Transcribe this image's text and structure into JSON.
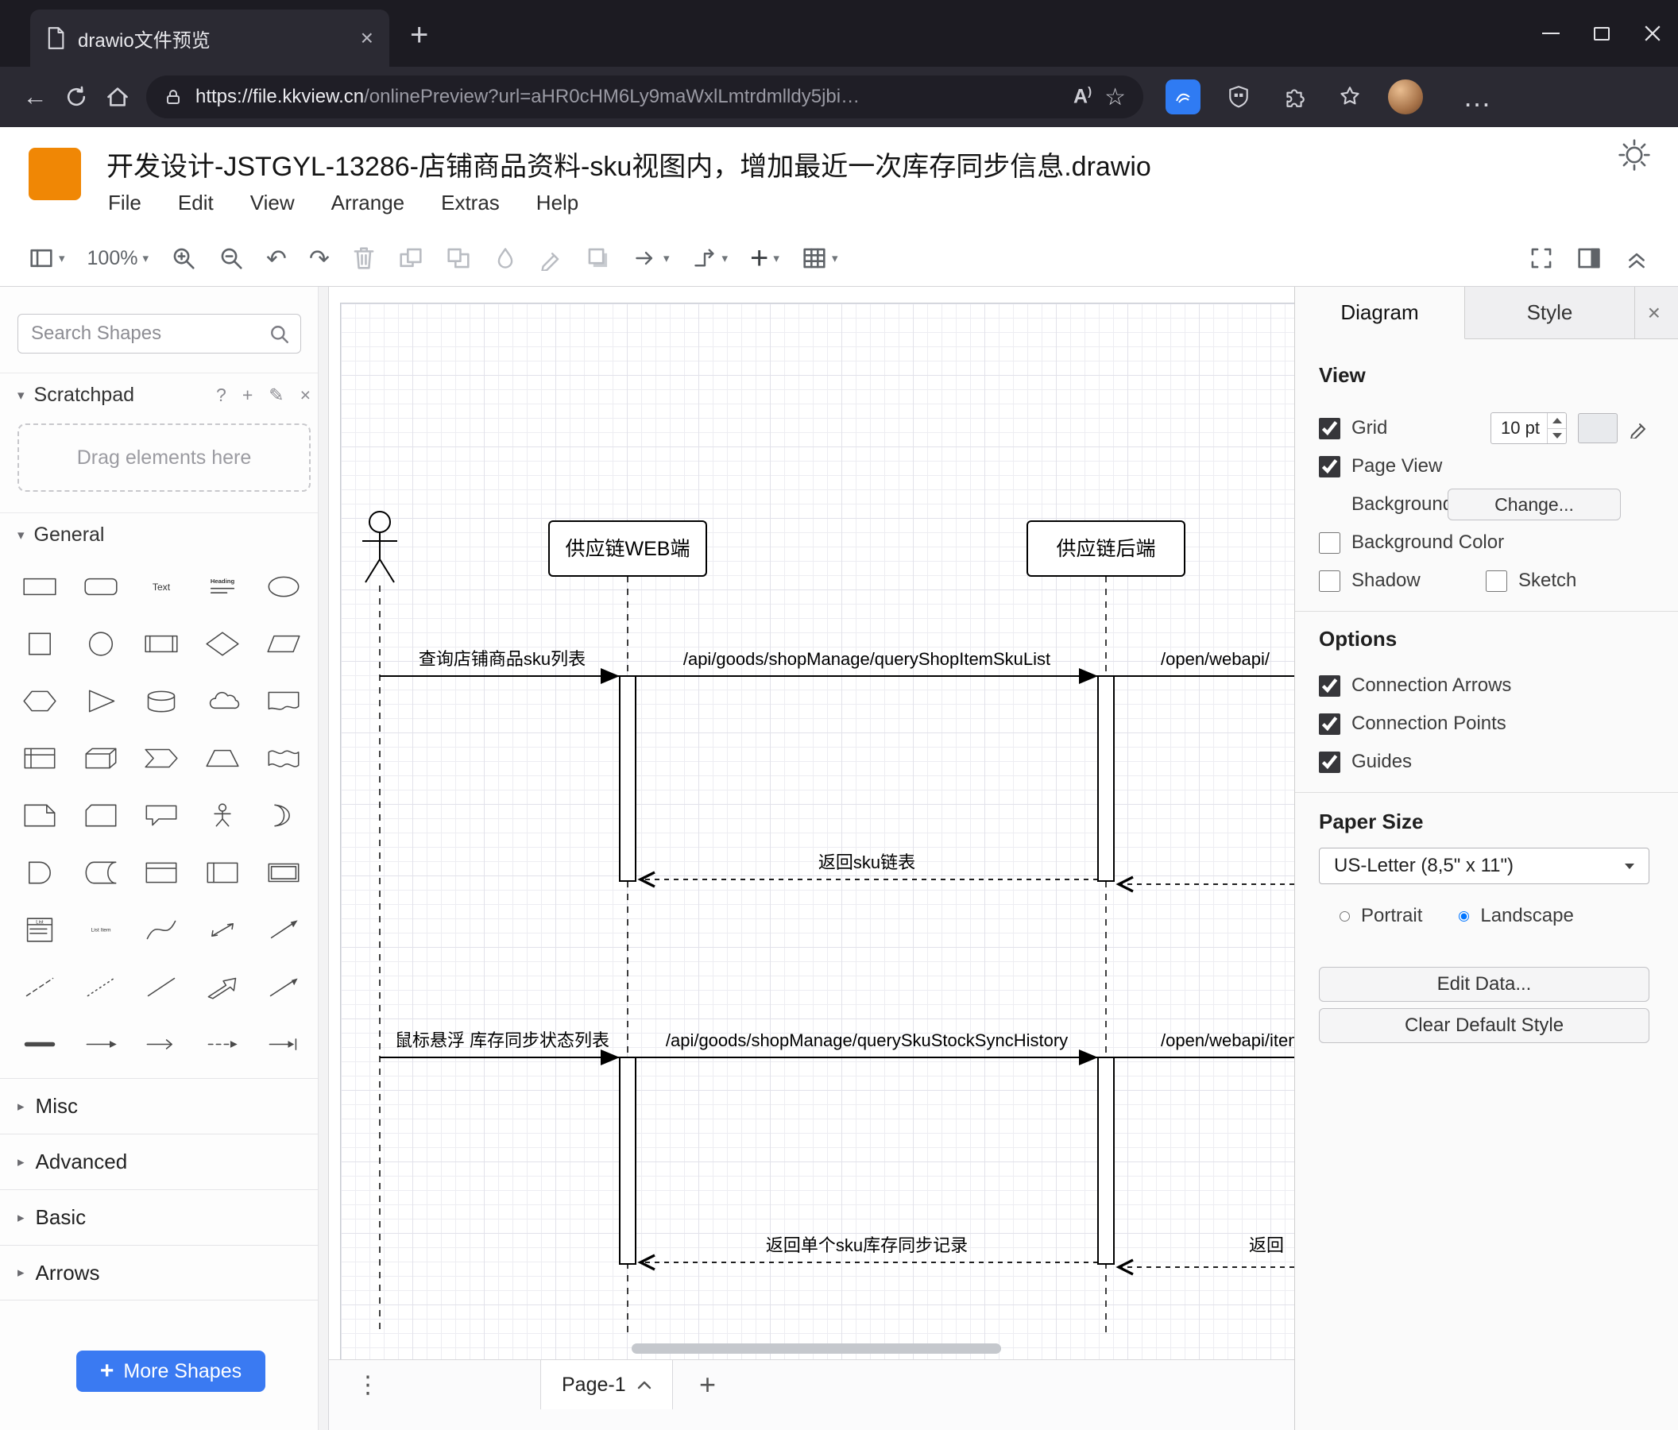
{
  "colors": {
    "accent_blue": "#3a7af2",
    "drawio_orange": "#f08705",
    "chrome_dark": "#1c1b22",
    "chrome_toolbar": "#2b2a33"
  },
  "browser": {
    "tab_title": "drawio文件预览",
    "url_main": "https://file.kkview.cn",
    "url_path": "/onlinePreview?url=aHR0cHM6Ly9maWxlLmtrdmlldy5jbi…",
    "icons": {
      "read_aloud": "A"
    }
  },
  "app": {
    "title": "开发设计-JSTGYL-13286-店铺商品资料-sku视图内，增加最近一次库存同步信息.drawio",
    "menus": [
      "File",
      "Edit",
      "View",
      "Arrange",
      "Extras",
      "Help"
    ],
    "zoom_level": "100%"
  },
  "sidebar": {
    "search_placeholder": "Search Shapes",
    "scratchpad_title": "Scratchpad",
    "drop_hint": "Drag elements here",
    "section_general": "General",
    "section_misc": "Misc",
    "section_advanced": "Advanced",
    "section_basic": "Basic",
    "section_arrows": "Arrows",
    "more_shapes_label": "More Shapes",
    "shape_labels": {
      "text": "Text",
      "heading": "Heading",
      "list": "List",
      "list_item": "List Item"
    },
    "general_shapes": [
      "rectangle",
      "rounded-rectangle",
      "text",
      "heading",
      "ellipse",
      "square",
      "circle",
      "process",
      "diamond",
      "parallelogram",
      "hexagon",
      "triangle",
      "cylinder",
      "cloud",
      "document",
      "internal-storage",
      "cube",
      "step",
      "trapezoid",
      "tape",
      "note",
      "card",
      "callout",
      "actor",
      "or",
      "and",
      "data-storage",
      "container",
      "vertical-container",
      "horizontal-container",
      "list",
      "list-item",
      "curve",
      "bidirectional-arrow",
      "arrow",
      "dashed-line",
      "dotted-line",
      "line",
      "directional-arrow",
      "thin-arrow",
      "link",
      "arrow-right",
      "simple-arrow",
      "dashed-arrow",
      "bar-arrow"
    ]
  },
  "diagram": {
    "participants": {
      "web": "供应链WEB端",
      "backend": "供应链后端"
    },
    "labels": {
      "msg_query_list": "查询店铺商品sku列表",
      "api_query_list": "/api/goods/shopManage/queryShopItemSkuList",
      "api_open_webapi": "/open/webapi/",
      "ret_sku_list": "返回sku链表",
      "msg_hover_history": "鼠标悬浮 库存同步状态列表",
      "api_query_history": "/api/goods/shopManage/querySkuStockSyncHistory",
      "api_open_webapi_item": "/open/webapi/item",
      "ret_single_record": "返回单个sku库存同步记录",
      "ret_partial": "返回"
    }
  },
  "footer": {
    "page_label": "Page-1"
  },
  "format_panel": {
    "tab_diagram": "Diagram",
    "tab_style": "Style",
    "view_heading": "View",
    "grid_label": "Grid",
    "grid_size": "10 pt",
    "page_view_label": "Page View",
    "background_label": "Background",
    "change_button": "Change...",
    "background_color_label": "Background Color",
    "shadow_label": "Shadow",
    "sketch_label": "Sketch",
    "options_heading": "Options",
    "connection_arrows_label": "Connection Arrows",
    "connection_points_label": "Connection Points",
    "guides_label": "Guides",
    "paper_heading": "Paper Size",
    "paper_size_value": "US-Letter (8,5\" x 11\")",
    "portrait_label": "Portrait",
    "landscape_label": "Landscape",
    "edit_data_button": "Edit Data...",
    "clear_default_button": "Clear Default Style",
    "checks": {
      "grid": true,
      "page_view": true,
      "background_color": false,
      "shadow": false,
      "sketch": false,
      "connection_arrows": true,
      "connection_points": true,
      "guides": true,
      "portrait": false,
      "landscape": true
    }
  }
}
